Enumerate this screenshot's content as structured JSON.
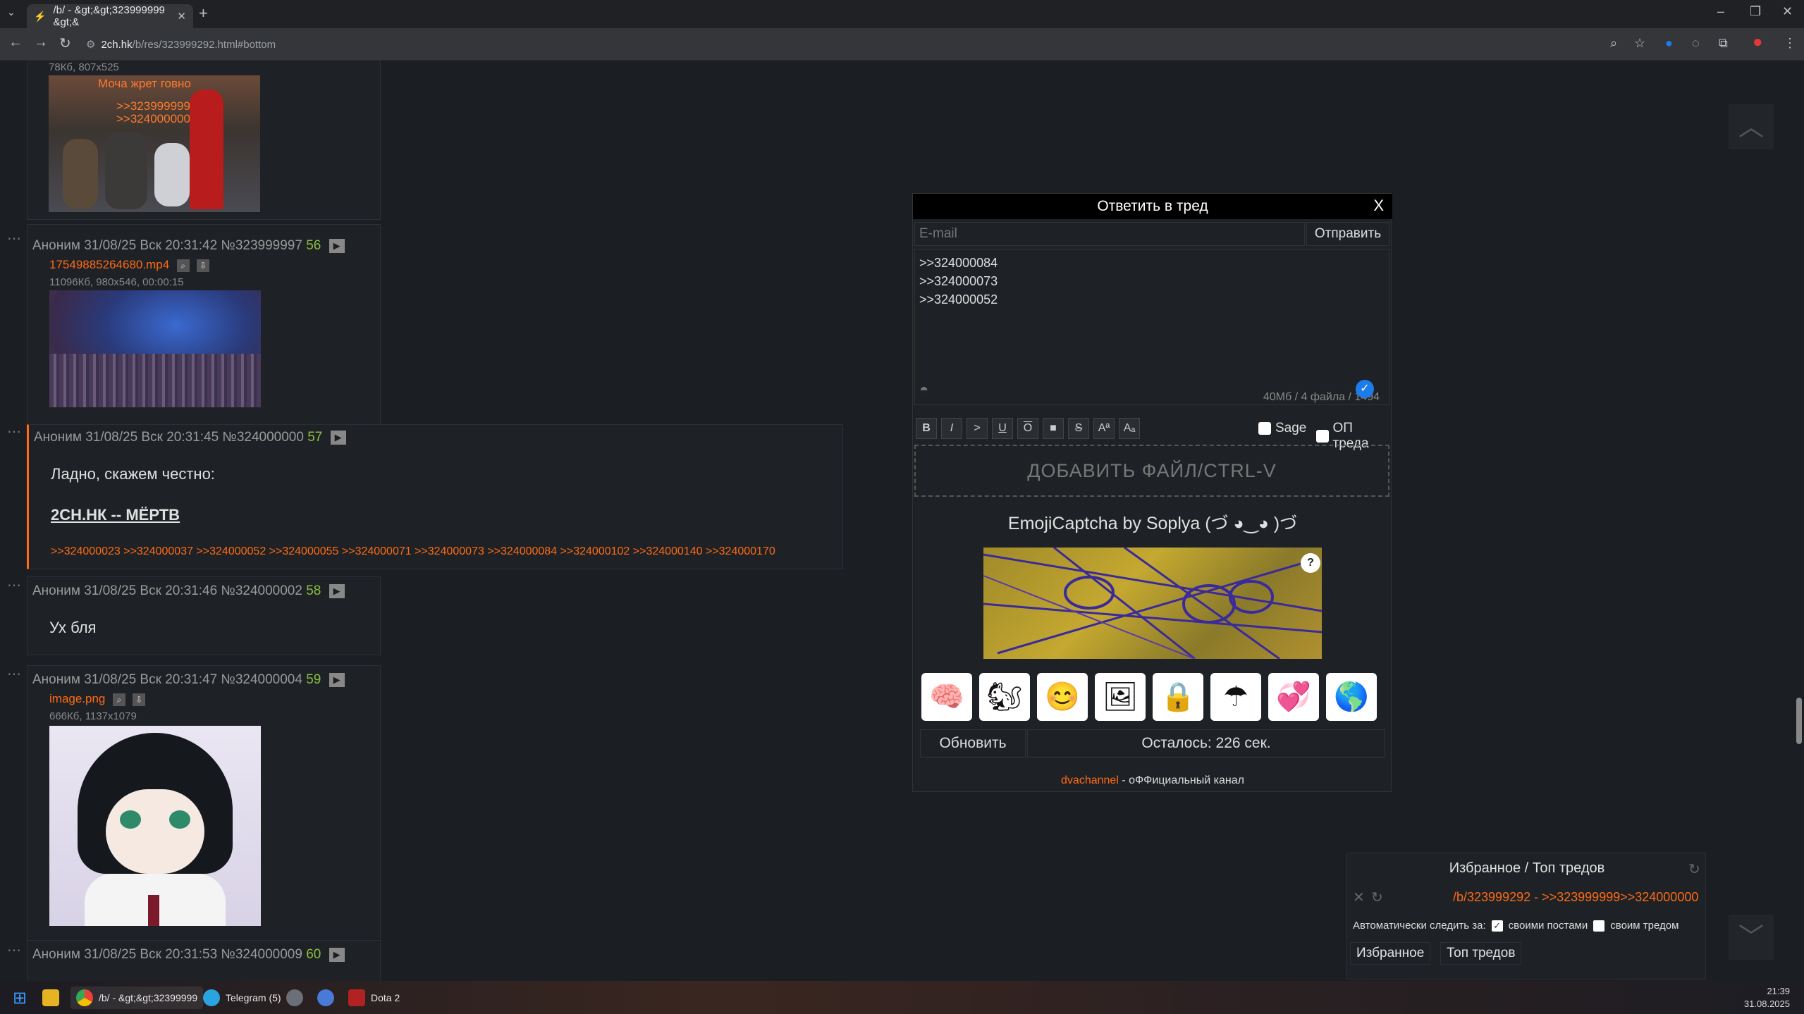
{
  "browser": {
    "tab_title": "/b/ - &gt;&gt;323999999 &gt;&",
    "tab_favicon": "lightning-icon",
    "new_tab": "+",
    "url_host": "2ch.hk",
    "url_path": "/b/res/323999292.html#bottom",
    "window_controls": [
      "–",
      "❐",
      "✕"
    ]
  },
  "posts": [
    {
      "author": "Аноним",
      "date": "31/08/25 Вск 20:31:42",
      "id": "№323999997",
      "index": "56",
      "file_name": "17549885264680.mp4",
      "file_meta": "11096Кб, 980x546, 00:00:15"
    },
    {
      "author": "Аноним",
      "date": "31/08/25 Вск 20:31:45",
      "id": "№324000000",
      "index": "57",
      "line1": "Ладно, скажем честно:",
      "line2": "2СН.НК -- МЁРТВ",
      "replies": ">>324000023 >>324000037 >>324000052 >>324000055 >>324000071 >>324000073 >>324000084 >>324000102 >>324000140 >>324000170"
    },
    {
      "author": "Аноним",
      "date": "31/08/25 Вск 20:31:46",
      "id": "№324000002",
      "index": "58",
      "text": "Ух бля"
    },
    {
      "author": "Аноним",
      "date": "31/08/25 Вск 20:31:47",
      "id": "№324000004",
      "index": "59",
      "file_name": "image.png",
      "file_meta": "666Кб, 1137x1079"
    },
    {
      "author": "Аноним",
      "date": "31/08/25 Вск 20:31:53",
      "id": "№324000009",
      "index": "60"
    }
  ],
  "top_post": {
    "file_meta": "78Кб, 807x525",
    "caption": "Моча жрет говно",
    "refs": [
      ">>323999999",
      ">>324000000"
    ]
  },
  "reply_form": {
    "title": "Ответить в тред",
    "close": "X",
    "email_placeholder": "E-mail",
    "send": "Отправить",
    "text_lines": [
      ">>324000084",
      ">>324000073",
      ">>324000052"
    ],
    "counter": "40Мб / 4 файла / 1494",
    "format_buttons": [
      "B",
      "I",
      ">",
      "U",
      "O",
      "■",
      "S",
      "Aª",
      "Aₐ"
    ],
    "sage": "Sage",
    "op": "ОП треда",
    "add_file": "ДОБАВИТЬ ФАЙЛ/CTRL-V",
    "captcha_title": "EmojiCaptcha by Soplya (づ ◕‿◕ )づ",
    "captcha_help": "?",
    "emojis": [
      "🧠",
      "🐿",
      "😊",
      "🖼",
      "🔒",
      "☂",
      "💞",
      "🌎"
    ],
    "refresh": "Обновить",
    "remaining": "Осталось: 226 сек.",
    "channel_link": "dvachannel",
    "channel_text": " - оФФициальный канал"
  },
  "favorites": {
    "title": "Избранное / Топ тредов",
    "thread": "/b/323999292 - >>323999999>>324000000",
    "auto_watch": "Автоматически следить за:",
    "own_posts": "своими постами",
    "own_thread": "своим тредом",
    "tab_fav": "Избранное",
    "tab_top": "Топ тредов"
  },
  "taskbar": {
    "chrome_label": "/b/ - &gt;&gt;32399999",
    "telegram_label": "Telegram (5)",
    "dota_label": "Dota 2",
    "time": "21:39",
    "date": "31.08.2025"
  },
  "colors": {
    "accent": "#ff6a13",
    "post_num": "#8bbf3f",
    "background": "#1b1e22"
  }
}
